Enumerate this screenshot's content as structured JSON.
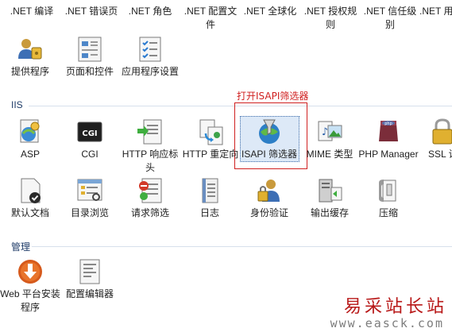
{
  "top_row": [
    {
      "label": ".NET 编译",
      "icon": "net-compile-icon"
    },
    {
      "label": ".NET 错误页",
      "icon": "net-error-page-icon"
    },
    {
      "label": ".NET 角色",
      "icon": "net-roles-icon"
    },
    {
      "label": ".NET 配置文件",
      "icon": "net-profile-icon"
    },
    {
      "label": ".NET 全球化",
      "icon": "net-globalization-icon"
    },
    {
      "label": ".NET 授权规则",
      "icon": "net-authorization-icon"
    },
    {
      "label": ".NET 信任级别",
      "icon": "net-trust-icon"
    },
    {
      "label": ".NET 用",
      "icon": "net-users-icon"
    }
  ],
  "aspnet_row2": [
    {
      "label": "提供程序",
      "icon": "providers-icon"
    },
    {
      "label": "页面和控件",
      "icon": "pages-controls-icon"
    },
    {
      "label": "应用程序设置",
      "icon": "app-settings-icon"
    }
  ],
  "iis": {
    "title": "IIS",
    "row1": [
      {
        "label": "ASP",
        "icon": "asp-icon"
      },
      {
        "label": "CGI",
        "icon": "cgi-icon"
      },
      {
        "label": "HTTP 响应标头",
        "icon": "http-response-headers-icon"
      },
      {
        "label": "HTTP 重定向",
        "icon": "http-redirect-icon"
      },
      {
        "label": "ISAPI 筛选器",
        "icon": "isapi-filters-icon"
      },
      {
        "label": "MIME 类型",
        "icon": "mime-types-icon"
      },
      {
        "label": "PHP Manager",
        "icon": "php-manager-icon"
      },
      {
        "label": "SSL 设",
        "icon": "ssl-settings-icon"
      }
    ],
    "row2": [
      {
        "label": "默认文档",
        "icon": "default-document-icon"
      },
      {
        "label": "目录浏览",
        "icon": "directory-browsing-icon"
      },
      {
        "label": "请求筛选",
        "icon": "request-filtering-icon"
      },
      {
        "label": "日志",
        "icon": "logging-icon"
      },
      {
        "label": "身份验证",
        "icon": "authentication-icon"
      },
      {
        "label": "输出缓存",
        "icon": "output-caching-icon"
      },
      {
        "label": "压缩",
        "icon": "compression-icon"
      }
    ]
  },
  "management": {
    "title": "管理",
    "items": [
      {
        "label": "Web 平台安装程序",
        "icon": "web-platform-installer-icon"
      },
      {
        "label": "配置编辑器",
        "icon": "configuration-editor-icon"
      }
    ]
  },
  "callout": {
    "text": "打开ISAPI筛选器",
    "color": "#d02020"
  },
  "watermark": {
    "site_name": "易采站长站",
    "url": "www.easck.com"
  },
  "colors": {
    "selection": "#dde9f7",
    "section_title": "#1e3b68",
    "divider": "#d7e0ec"
  }
}
